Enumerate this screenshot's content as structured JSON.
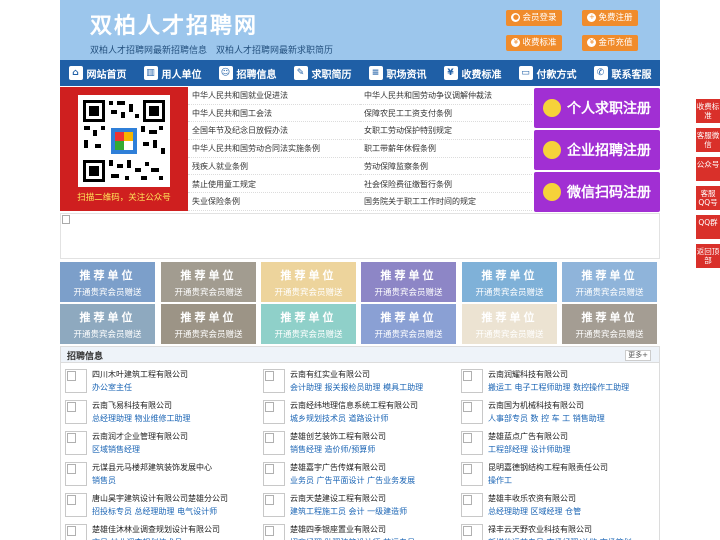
{
  "header": {
    "title": "双柏人才招聘网",
    "subtitle": "双柏人才招聘网最新招聘信息　双柏人才招聘网最新求职简历",
    "buttons": [
      "会员登录",
      "免费注册",
      "收费标准",
      "金币充值"
    ]
  },
  "nav": [
    "网站首页",
    "用人单位",
    "招聘信息",
    "求职简历",
    "职场资讯",
    "收费标准",
    "付款方式",
    "联系客服"
  ],
  "qr": {
    "caption": "扫描二维码，关注公众号"
  },
  "laws": [
    [
      "中华人民共和国就业促进法",
      "中华人民共和国劳动争议调解仲裁法"
    ],
    [
      "中华人民共和国工会法",
      "保障农民工工资支付条例"
    ],
    [
      "全国年节及纪念日放假办法",
      "女职工劳动保护特别规定"
    ],
    [
      "中华人民共和国劳动合同法实施条例",
      "职工带薪年休假条例"
    ],
    [
      "残疾人就业条例",
      "劳动保障监察条例"
    ],
    [
      "禁止使用童工规定",
      "社会保险费征缴暂行条例"
    ],
    [
      "失业保险条例",
      "国务院关于职工工作时间的规定"
    ]
  ],
  "register": [
    "个人求职注册",
    "企业招聘注册",
    "微信扫码注册"
  ],
  "side_float": [
    "收费标准",
    "客服微信",
    "公众号",
    "客服QQ号",
    "QQ群",
    "返回顶部"
  ],
  "member_slot": {
    "title": "推荐单位",
    "subtitle": "开通贵宾会员赠送"
  },
  "slot_colors": [
    "#7c9fca",
    "#a29c90",
    "#edd49c",
    "#8d86c6",
    "#7fb1d8",
    "#8fb4da",
    "#8ea9bf",
    "#9c9486",
    "#8fd0c9",
    "#8aa0d4",
    "#ece3d2",
    "#a49d93"
  ],
  "jobs": {
    "title": "招聘信息",
    "more": "更多+",
    "items": [
      {
        "company": "四川木叶建筑工程有限公司",
        "positions": "办公室主任"
      },
      {
        "company": "云南有红实业有限公司",
        "positions": "会计助理 报关报检员助理 模具工助理"
      },
      {
        "company": "云南润耀科技有限公司",
        "positions": "搬运工 电子工程师助理 数控操作工助理"
      },
      {
        "company": "云南飞易科技有限公司",
        "positions": "总经理助理 物业维修工助理"
      },
      {
        "company": "云南经纬地理信息系统工程有限公司",
        "positions": "城乡规划技术员 道路设计师"
      },
      {
        "company": "云南国为机械科技有限公司",
        "positions": "人事部专员 数 控 车 工 销售助理"
      },
      {
        "company": "云南润才企业管理有限公司",
        "positions": "区域销售经理"
      },
      {
        "company": "楚雄创艺装饰工程有限公司",
        "positions": "销售经理 造价师/预算师"
      },
      {
        "company": "楚雄蓝点广告有限公司",
        "positions": "工程部经理 设计师助理"
      },
      {
        "company": "元谋县元马楼邦建筑装饰发展中心",
        "positions": "销售员"
      },
      {
        "company": "楚雄嘉宇广告传媒有限公司",
        "positions": "业务员 广告平面设计 广告业务发展"
      },
      {
        "company": "昆明嘉德钢结构工程有限责任公司",
        "positions": "操作工"
      },
      {
        "company": "唐山昊宇建筑设计有限公司楚雄分公司",
        "positions": "招投标专员 总经理助理 电气设计师"
      },
      {
        "company": "云南天楚建设工程有限公司",
        "positions": "建筑工程施工员 会计 一级建造师"
      },
      {
        "company": "楚雄丰收乐农资有限公司",
        "positions": "总经理助理 区域经理 仓管"
      },
      {
        "company": "楚雄佳沐林业调查规划设计有限公司",
        "positions": "文员 林业调查规划技术员"
      },
      {
        "company": "楚雄四季银座置业有限公司",
        "positions": "招商经理 助理建筑设计师 营运专员"
      },
      {
        "company": "禄丰云天野农业科技有限公司",
        "positions": "新媒体运营专员 市场经理/总监 市场策划"
      }
    ]
  }
}
